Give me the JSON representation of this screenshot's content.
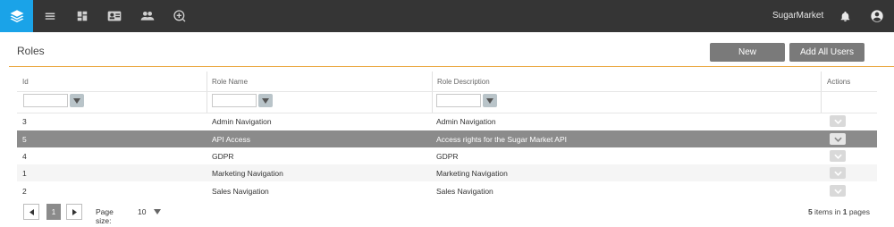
{
  "topbar": {
    "brand_icon": "layers-icon",
    "nav_icons": [
      "menu-icon",
      "dashboard-icon",
      "contact-card-icon",
      "people-icon",
      "add-circle-icon"
    ],
    "account_name": "SugarMarket",
    "accent_color": "#1aa3e8"
  },
  "page": {
    "title": "Roles",
    "new_button": "New",
    "add_all_users_button": "Add All Users"
  },
  "grid": {
    "columns": [
      "Id",
      "Role Name",
      "Role Description",
      "Actions"
    ],
    "rows": [
      {
        "id": "3",
        "name": "Admin Navigation",
        "description": "Admin Navigation"
      },
      {
        "id": "5",
        "name": "API Access",
        "description": "Access rights for the Sugar Market API"
      },
      {
        "id": "4",
        "name": "GDPR",
        "description": "GDPR"
      },
      {
        "id": "1",
        "name": "Marketing Navigation",
        "description": "Marketing Navigation"
      },
      {
        "id": "2",
        "name": "Sales Navigation",
        "description": "Sales Navigation"
      }
    ],
    "selected_row_index": 1
  },
  "pager": {
    "current_page": "1",
    "page_size_label": "Page size:",
    "page_size": "10",
    "item_count": "5",
    "info_middle": "items in",
    "page_count": "1",
    "info_end": "pages"
  }
}
